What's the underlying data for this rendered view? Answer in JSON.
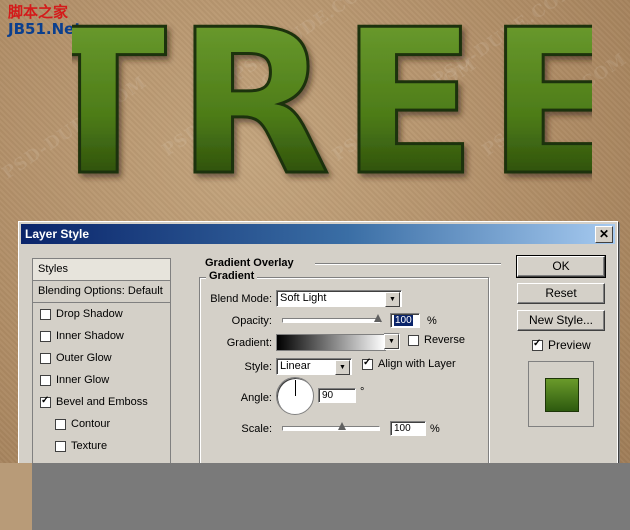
{
  "site": {
    "logo_cn": "脚本之家",
    "logo_en": "JB51.Net"
  },
  "hero": {
    "word": "TREE",
    "watermark": "PSD-DUDE.COM"
  },
  "dialog": {
    "title": "Layer Style",
    "close_glyph": "✕",
    "styles_panel": {
      "header": "Styles",
      "blending_options": "Blending Options: Default",
      "effects": [
        {
          "label": "Drop Shadow",
          "checked": false,
          "sub": false
        },
        {
          "label": "Inner Shadow",
          "checked": false,
          "sub": false
        },
        {
          "label": "Outer Glow",
          "checked": false,
          "sub": false
        },
        {
          "label": "Inner Glow",
          "checked": false,
          "sub": false
        },
        {
          "label": "Bevel and Emboss",
          "checked": true,
          "sub": false
        },
        {
          "label": "Contour",
          "checked": false,
          "sub": true
        },
        {
          "label": "Texture",
          "checked": false,
          "sub": true
        }
      ]
    },
    "gradient_overlay": {
      "section_title": "Gradient Overlay",
      "group_title": "Gradient",
      "blend_mode_label": "Blend Mode:",
      "blend_mode_value": "Soft Light",
      "opacity_label": "Opacity:",
      "opacity_value": "100",
      "opacity_unit": "%",
      "opacity_level": 1.0,
      "gradient_label": "Gradient:",
      "reverse_label": "Reverse",
      "reverse_checked": false,
      "style_label": "Style:",
      "style_value": "Linear",
      "align_label": "Align with Layer",
      "align_checked": true,
      "angle_label": "Angle:",
      "angle_value": "90",
      "angle_unit": "°",
      "scale_label": "Scale:",
      "scale_value": "100",
      "scale_unit": "%",
      "scale_level": 0.62
    },
    "buttons": {
      "ok": "OK",
      "reset": "Reset",
      "new_style": "New Style..."
    },
    "preview": {
      "label": "Preview",
      "checked": true
    }
  },
  "colors": {
    "accent_titlebar": "#0a246a",
    "tree_green": "#4f7e1c",
    "bg_cardboard": "#b08d66"
  }
}
